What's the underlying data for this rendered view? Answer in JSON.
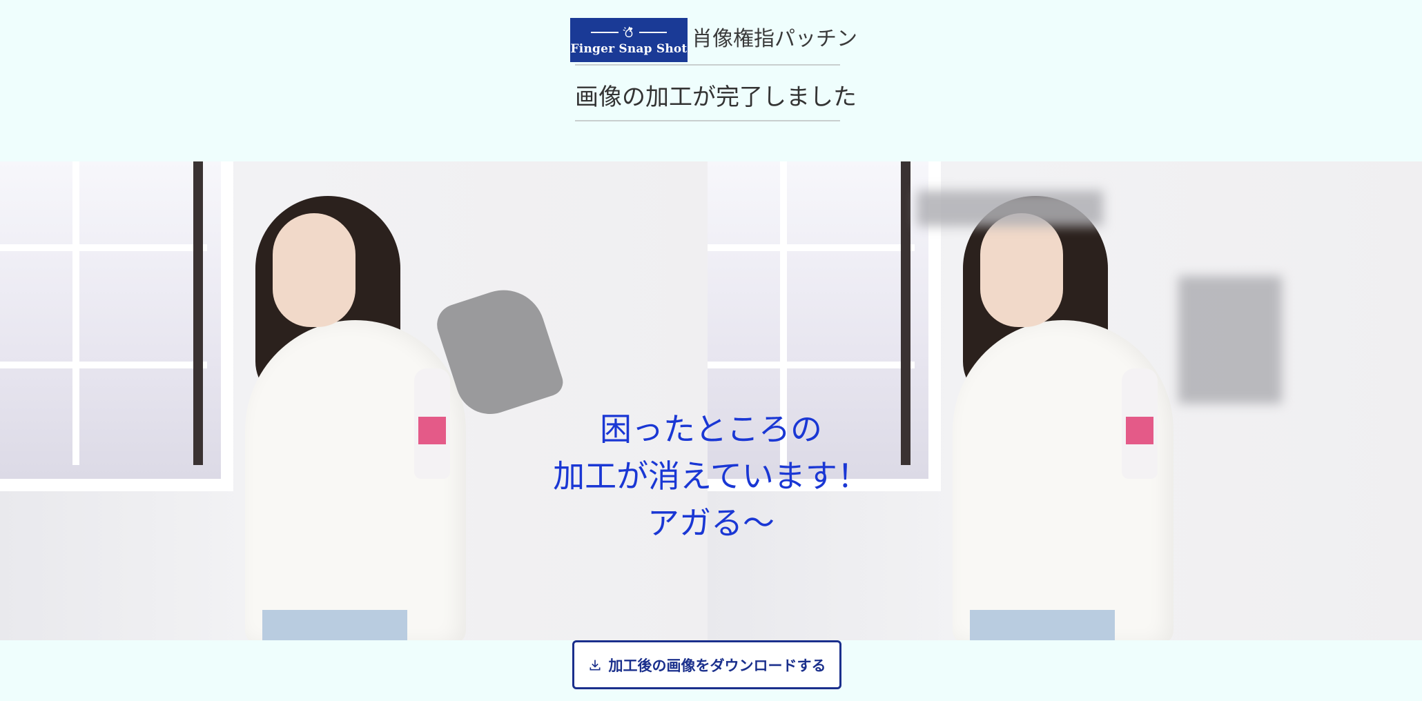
{
  "header": {
    "logo_text": "Finger Snap Shot",
    "app_name": "肖像権指パッチン"
  },
  "page_title": "画像の加工が完了しました",
  "result_message": {
    "line1": "困ったところの",
    "line2": "加工が消えています！",
    "line3": "アガる〜"
  },
  "download_button": {
    "label": "加工後の画像をダウンロードする",
    "icon": "download-icon"
  },
  "colors": {
    "page_background": "#effefd",
    "brand": "#1a3a96",
    "message": "#1a37d4",
    "button_border": "#1a2f8c"
  }
}
